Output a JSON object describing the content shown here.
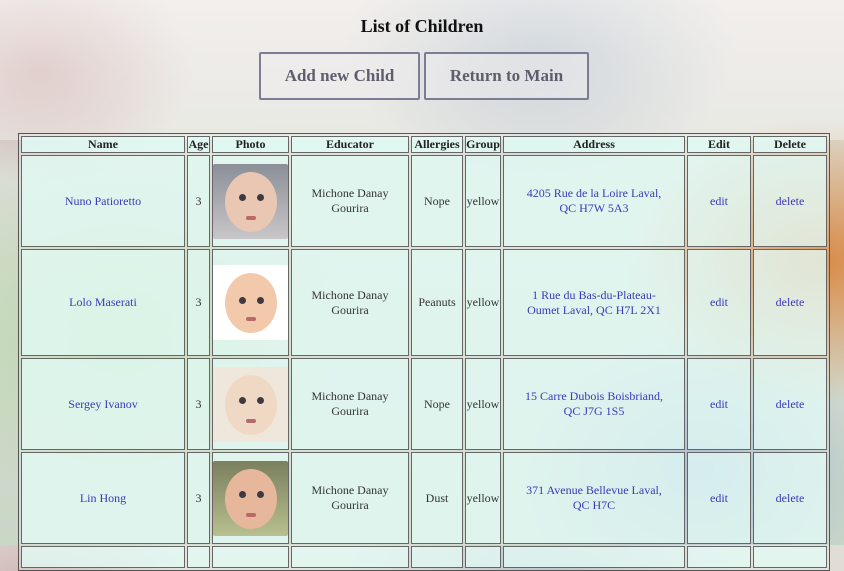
{
  "page": {
    "title": "List of Children"
  },
  "buttons": {
    "add_label": "Add new Child",
    "return_label": "Return to Main"
  },
  "table": {
    "headers": [
      "Name",
      "Age",
      "Photo",
      "Educator",
      "Allergies",
      "Group",
      "Address",
      "Edit",
      "Delete"
    ],
    "rows": [
      {
        "name": "Nuno Patioretto",
        "age": "3",
        "photo": "child-photo-icon",
        "educator": "Michone Danay Gourira",
        "allergies": "Nope",
        "group": "yellow",
        "address": "4205 Rue de la Loire Laval, QC H7W 5A3",
        "edit": "edit",
        "delete": "delete"
      },
      {
        "name": "Lolo Maserati",
        "age": "3",
        "photo": "child-photo-icon",
        "educator": "Michone Danay Gourira",
        "allergies": "Peanuts",
        "group": "yellow",
        "address": "1 Rue du Bas-du-Plateau-Oumet Laval, QC H7L 2X1",
        "edit": "edit",
        "delete": "delete"
      },
      {
        "name": "Sergey Ivanov",
        "age": "3",
        "photo": "child-photo-icon",
        "educator": "Michone Danay Gourira",
        "allergies": "Nope",
        "group": "yellow",
        "address": "15 Carre Dubois Boisbriand, QC J7G 1S5",
        "edit": "edit",
        "delete": "delete"
      },
      {
        "name": "Lin Hong",
        "age": "3",
        "photo": "child-photo-icon",
        "educator": "Michone Danay Gourira",
        "allergies": "Dust",
        "group": "yellow",
        "address": "371 Avenue Bellevue Laval, QC H7C",
        "edit": "edit",
        "delete": "delete"
      }
    ]
  },
  "colors": {
    "link": "#3a3ab8",
    "cell_bg": "#e1faf5",
    "button_border": "#7c7c94"
  }
}
